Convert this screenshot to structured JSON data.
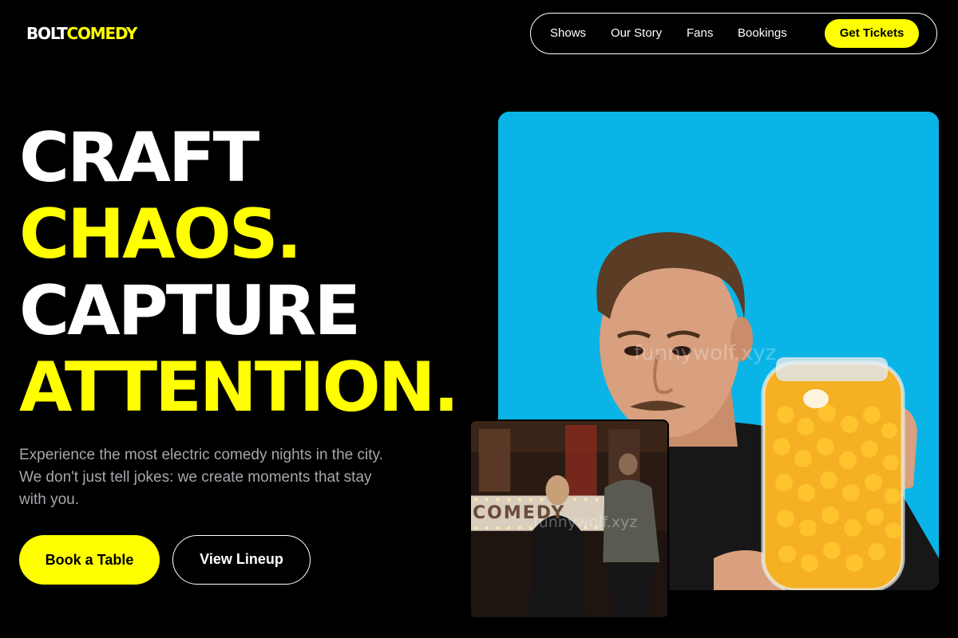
{
  "brand": {
    "logo_part_1": "BOLT",
    "logo_part_2": "COMEDY",
    "accent_color": "#ffff00",
    "background_color": "#000000"
  },
  "nav": {
    "items": [
      {
        "label": "Shows"
      },
      {
        "label": "Our Story"
      },
      {
        "label": "Fans"
      },
      {
        "label": "Bookings"
      }
    ],
    "cta_label": "Get Tickets"
  },
  "hero": {
    "headline": {
      "line_1": "CRAFT",
      "line_2": "CHAOS.",
      "line_3": "CAPTURE",
      "line_4": "ATTENTION."
    },
    "description": "Experience the most electric comedy nights in the city. We don't just tell jokes: we create moments that stay with you.",
    "primary_button": "Book a Table",
    "secondary_button": "View Lineup"
  },
  "images": {
    "main_photo": {
      "watermark": "funnywolf.xyz",
      "background_color": "#0bb4e6"
    },
    "inset_photo": {
      "watermark": "funnywolf.xyz",
      "sign_text": "COMEDY"
    }
  }
}
